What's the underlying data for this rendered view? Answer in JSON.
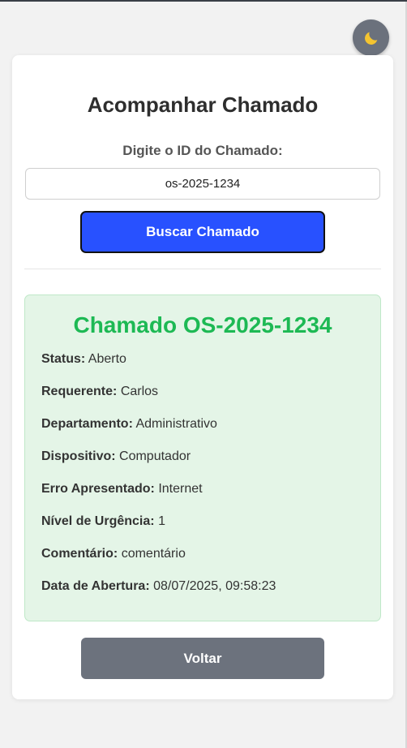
{
  "theme_toggle": {
    "icon": "moon-icon",
    "color": "#f4c430"
  },
  "header": {
    "title": "Acompanhar Chamado"
  },
  "search": {
    "label": "Digite o ID do Chamado:",
    "value": "os-2025-1234",
    "button_label": "Buscar Chamado"
  },
  "result": {
    "title": "Chamado OS-2025-1234",
    "fields": [
      {
        "label": "Status:",
        "value": "Aberto"
      },
      {
        "label": "Requerente:",
        "value": "Carlos"
      },
      {
        "label": "Departamento:",
        "value": "Administrativo"
      },
      {
        "label": "Dispositivo:",
        "value": "Computador"
      },
      {
        "label": "Erro Apresentado:",
        "value": "Internet"
      },
      {
        "label": "Nível de Urgência:",
        "value": "1"
      },
      {
        "label": "Comentário:",
        "value": "comentário"
      },
      {
        "label": "Data de Abertura:",
        "value": "08/07/2025, 09:58:23"
      }
    ]
  },
  "footer": {
    "back_label": "Voltar"
  },
  "colors": {
    "primary_button": "#2851ff",
    "secondary_button": "#6c727d",
    "success_title": "#1db954",
    "result_background": "#e4f5e7"
  }
}
